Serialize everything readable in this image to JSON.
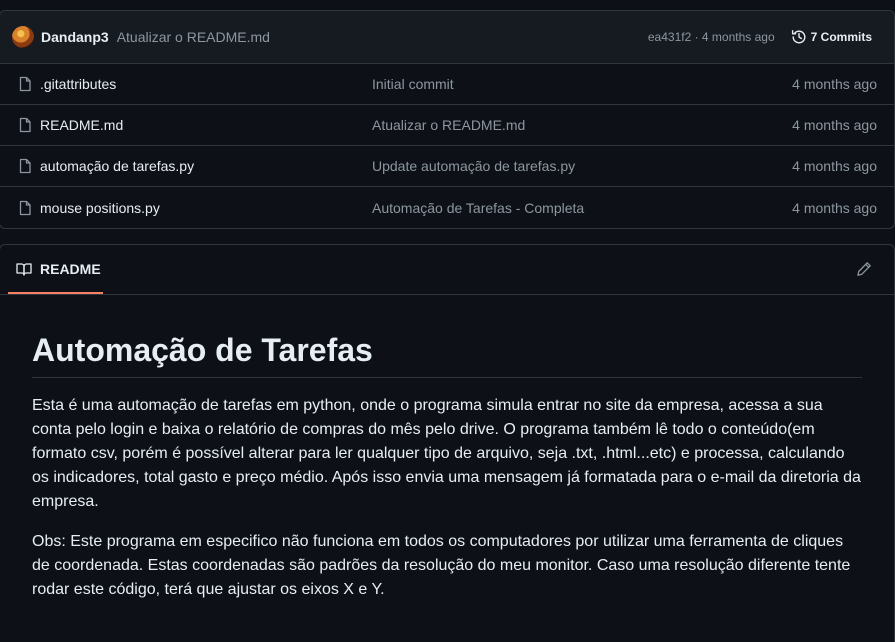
{
  "commit_bar": {
    "author": "Dandanp3",
    "message": "Atualizar o README.md",
    "meta": "ea431f2 · 4 months ago",
    "commits_label": "7 Commits"
  },
  "files": [
    {
      "name": ".gitattributes",
      "commit": "Initial commit",
      "date": "4 months ago"
    },
    {
      "name": "README.md",
      "commit": "Atualizar o README.md",
      "date": "4 months ago"
    },
    {
      "name": "automação de tarefas.py",
      "commit": "Update automação de tarefas.py",
      "date": "4 months ago"
    },
    {
      "name": "mouse positions.py",
      "commit": "Automação de Tarefas - Completa",
      "date": "4 months ago"
    }
  ],
  "readme": {
    "tab_label": "README",
    "title": "Automação de Tarefas",
    "paragraphs": [
      "Esta é uma automação de tarefas em python, onde o programa simula entrar no site da empresa, acessa a sua conta pelo login e baixa o relatório de compras do mês pelo drive. O programa também lê todo o conteúdo(em formato csv, porém é possível alterar para ler qualquer tipo de arquivo, seja .txt, .html...etc) e processa, calculando os indicadores, total gasto e preço médio. Após isso envia uma mensagem já formatada para o e-mail da diretoria da empresa.",
      "Obs: Este programa em especifico não funciona em todos os computadores por utilizar uma ferramenta de cliques de coordenada. Estas coordenadas são padrões da resolução do meu monitor. Caso uma resolução diferente tente rodar este código, terá que ajustar os eixos X e Y."
    ]
  },
  "icons": {
    "avatar": "user-avatar",
    "history": "history-icon",
    "file": "file-icon",
    "book": "book-icon",
    "edit": "pencil-icon"
  },
  "colors": {
    "background": "#0d1117",
    "header_bg": "#161b22",
    "border": "#30363d",
    "text": "#e6edf3",
    "muted": "#8d96a0",
    "tab_underline": "#f78166"
  }
}
